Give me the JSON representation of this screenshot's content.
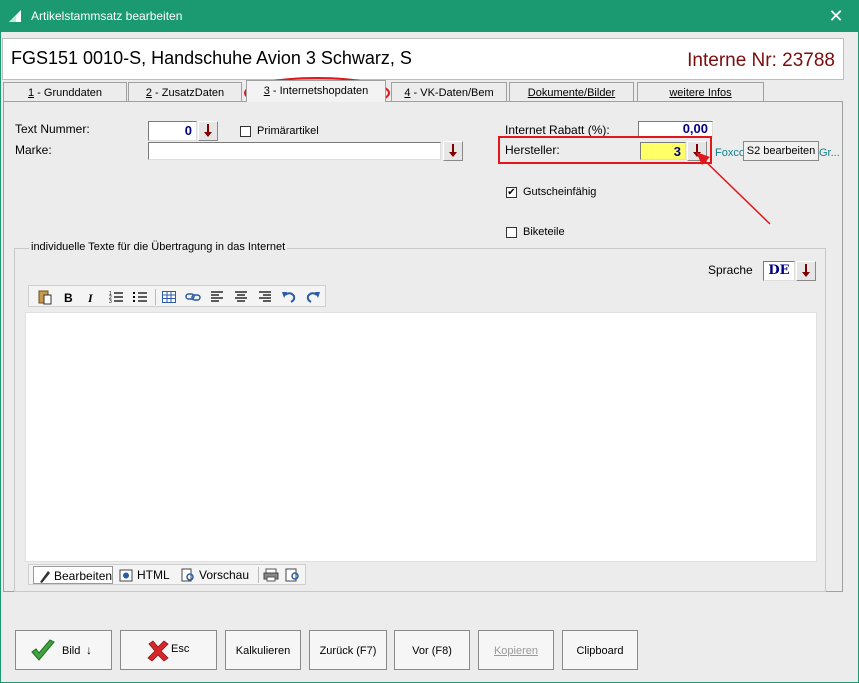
{
  "window": {
    "title": "Artikelstammsatz bearbeiten",
    "close_glyph": "✕"
  },
  "header": {
    "article_title": "FGS151 0010-S, Handschuhe Avion 3 Schwarz, S",
    "internal_nr": "Interne Nr: 23788"
  },
  "tabs": [
    {
      "num": "1",
      "label": " - Grunddaten"
    },
    {
      "num": "2",
      "label": " - ZusatzDaten"
    },
    {
      "num": "3",
      "label": " - Internetshopdaten"
    },
    {
      "num": "4",
      "label": " - VK-Daten/Bem"
    },
    {
      "num": "",
      "label": "Dokumente/Bilder"
    },
    {
      "num": "",
      "label": "weitere Infos"
    }
  ],
  "form": {
    "text_nummer_label": "Text Nummer:",
    "text_nummer_value": "0",
    "primaerartikel_label": "Primärartikel",
    "marke_label": "Marke:",
    "marke_value": "",
    "internet_rabatt_label": "Internet Rabatt (%):",
    "internet_rabatt_value": "0,00",
    "hersteller_label": "Hersteller:",
    "hersteller_value": "3",
    "hersteller_name_fragment": "Foxco",
    "s2_button": "S2 bearbeiten",
    "s2_fragment": "Gr...",
    "gutscheinfaehig_label": "Gutscheinfähig",
    "gutscheinfaehig_checked": "✔",
    "biketeile_label": "Biketeile"
  },
  "texts_group": {
    "legend": "individuelle Texte für die Übertragung in das Internet",
    "sprache_label": "Sprache",
    "sprache_value": "DE",
    "editor_content": "",
    "modes": {
      "edit": "Bearbeiten",
      "html": "HTML",
      "preview": "Vorschau"
    }
  },
  "buttons": {
    "bild": "Bild",
    "bild_suffix": "↓",
    "esc": "Esc",
    "kalkulieren": "Kalkulieren",
    "zurueck": "Zurück (F7)",
    "vor": "Vor (F8)",
    "kopieren": "Kopieren",
    "clipboard": "Clipboard"
  },
  "colors": {
    "titlebar": "#1b9a72",
    "internal_nr": "#7a0d0d",
    "highlight_field": "#ffff66",
    "annotation_red": "#e0171b",
    "field_text": "#000080"
  }
}
